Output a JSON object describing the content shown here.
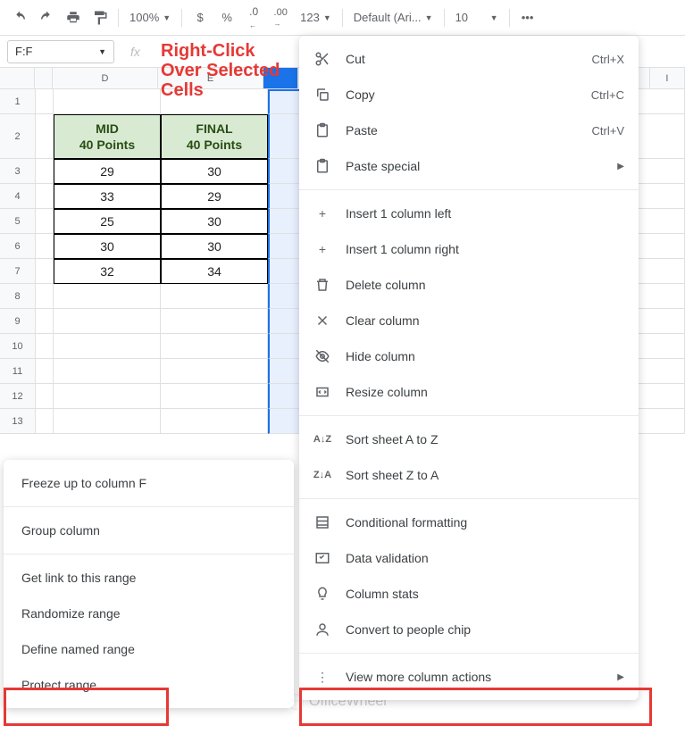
{
  "toolbar": {
    "zoom": "100%",
    "currency": "$",
    "percent": "%",
    "dec_less": ".0",
    "dec_more": ".00",
    "num_fmt": "123",
    "font": "Default (Ari...",
    "font_size": "10"
  },
  "name_box": "F:F",
  "annotation_line1": "Right-Click",
  "annotation_line2": "Over Selected",
  "annotation_line3": "Cells",
  "columns": {
    "D": "D",
    "E": "E",
    "I": "I"
  },
  "table": {
    "header_mid": "MID",
    "header_mid_pts": "40 Points",
    "header_final": "FINAL",
    "header_final_pts": "40 Points",
    "rows": [
      {
        "rn": "3",
        "mid": "29",
        "final": "30"
      },
      {
        "rn": "4",
        "mid": "33",
        "final": "29"
      },
      {
        "rn": "5",
        "mid": "25",
        "final": "30"
      },
      {
        "rn": "6",
        "mid": "30",
        "final": "30"
      },
      {
        "rn": "7",
        "mid": "32",
        "final": "34"
      }
    ]
  },
  "row_nums": [
    "1",
    "2",
    "3",
    "4",
    "5",
    "6",
    "7",
    "8",
    "9",
    "10",
    "11",
    "12",
    "13"
  ],
  "ctx": {
    "cut": "Cut",
    "cut_sc": "Ctrl+X",
    "copy": "Copy",
    "copy_sc": "Ctrl+C",
    "paste": "Paste",
    "paste_sc": "Ctrl+V",
    "paste_special": "Paste special",
    "ins_left": "Insert 1 column left",
    "ins_right": "Insert 1 column right",
    "del_col": "Delete column",
    "clear_col": "Clear column",
    "hide_col": "Hide column",
    "resize_col": "Resize column",
    "sort_az": "Sort sheet A to Z",
    "sort_za": "Sort sheet Z to A",
    "cond_fmt": "Conditional formatting",
    "data_val": "Data validation",
    "col_stats": "Column stats",
    "people_chip": "Convert to people chip",
    "view_more": "View more column actions"
  },
  "sub": {
    "freeze": "Freeze up to column F",
    "group": "Group column",
    "get_link": "Get link to this range",
    "randomize": "Randomize range",
    "named_range": "Define named range",
    "protect": "Protect range"
  },
  "watermark": "OfficeWheel"
}
